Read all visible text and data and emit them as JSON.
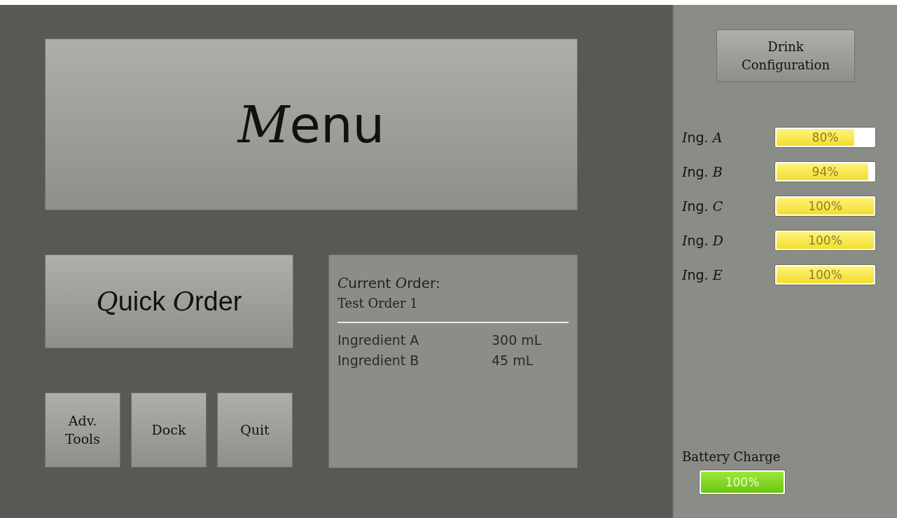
{
  "menu_banner": {
    "label": "Menu"
  },
  "quick_order_button": {
    "label": "Quick Order"
  },
  "tool_buttons": [
    "Adv.\nTools",
    "Dock",
    "Quit"
  ],
  "current_order": {
    "heading": "Current Order:",
    "name": "Test Order 1",
    "items": [
      {
        "ingredient": "Ingredient A",
        "amount": "300 mL"
      },
      {
        "ingredient": "Ingredient B",
        "amount": "45 mL"
      }
    ]
  },
  "drink_configuration_button": {
    "label": "Drink\nConfiguration"
  },
  "ingredients": [
    {
      "label": "Ing. A",
      "level": 0.8,
      "reading": "80%"
    },
    {
      "label": "Ing. B",
      "level": 0.94,
      "reading": "94%"
    },
    {
      "label": "Ing. C",
      "level": 1.0,
      "reading": "100%"
    },
    {
      "label": "Ing. D",
      "level": 1.0,
      "reading": "100%"
    },
    {
      "label": "Ing. E",
      "level": 1.0,
      "reading": "100%"
    }
  ],
  "battery": {
    "label": "Battery Charge",
    "level": 1.0,
    "reading": "100%"
  }
}
